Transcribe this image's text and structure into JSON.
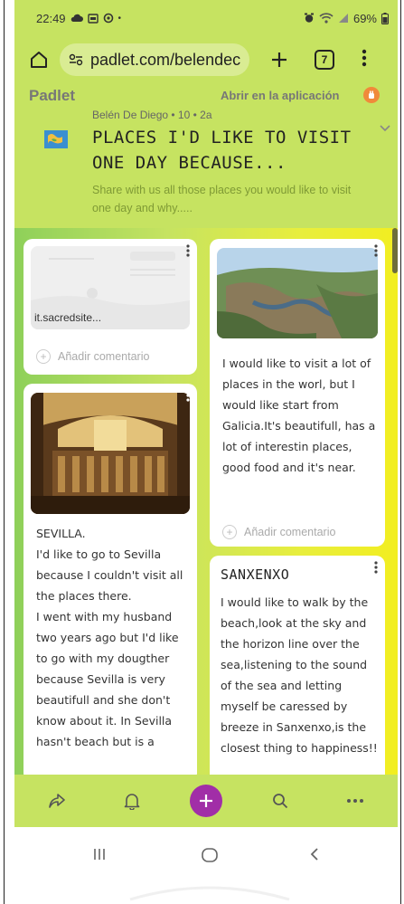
{
  "status_bar": {
    "time": "22:49",
    "battery": "69%"
  },
  "browser": {
    "url": "padlet.com/belendec",
    "tab_count": "7"
  },
  "padlet": {
    "logo_text": "Padlet",
    "open_in_app": "Abrir en la aplicación",
    "author_line": "Belén De Diego • 10 • 2a",
    "title": "PLACES I'D LIKE TO VISIT ONE DAY BECAUSE...",
    "description": "Share with  us all those places you would like to visit one day and why....."
  },
  "cards": [
    {
      "link_label": "it.sacredsite...",
      "comment_placeholder": "Añadir comentario"
    },
    {
      "body": "I would like to visit a lot of places in the worl, but I would like start from  Galicia.It's beautifull, has a lot of interestin places, good food and it's near.",
      "comment_placeholder": "Añadir comentario"
    },
    {
      "body": "SEVILLA.\nI'd like to go to Sevilla because I couldn't visit all the places there.\nI went with my husband two years ago but I'd like to go with my dougther because Sevilla is very beautifull and she don't know about it. In Sevilla hasn't beach but is a"
    },
    {
      "title": "SANXENXO",
      "body": "I would like to walk by the beach,look at the sky and the horizon line over the sea,listening to the sound of the sea and letting myself be caressed by breeze in Sanxenxo,is the closest thing to happiness!!"
    }
  ],
  "toolbar": {
    "icons": [
      "share-icon",
      "bell-icon",
      "add-icon",
      "search-icon",
      "more-icon"
    ]
  },
  "colors": {
    "header_bg": "#c6e361",
    "accent_purple": "#a12ea7",
    "description_text": "#7f9a35"
  }
}
